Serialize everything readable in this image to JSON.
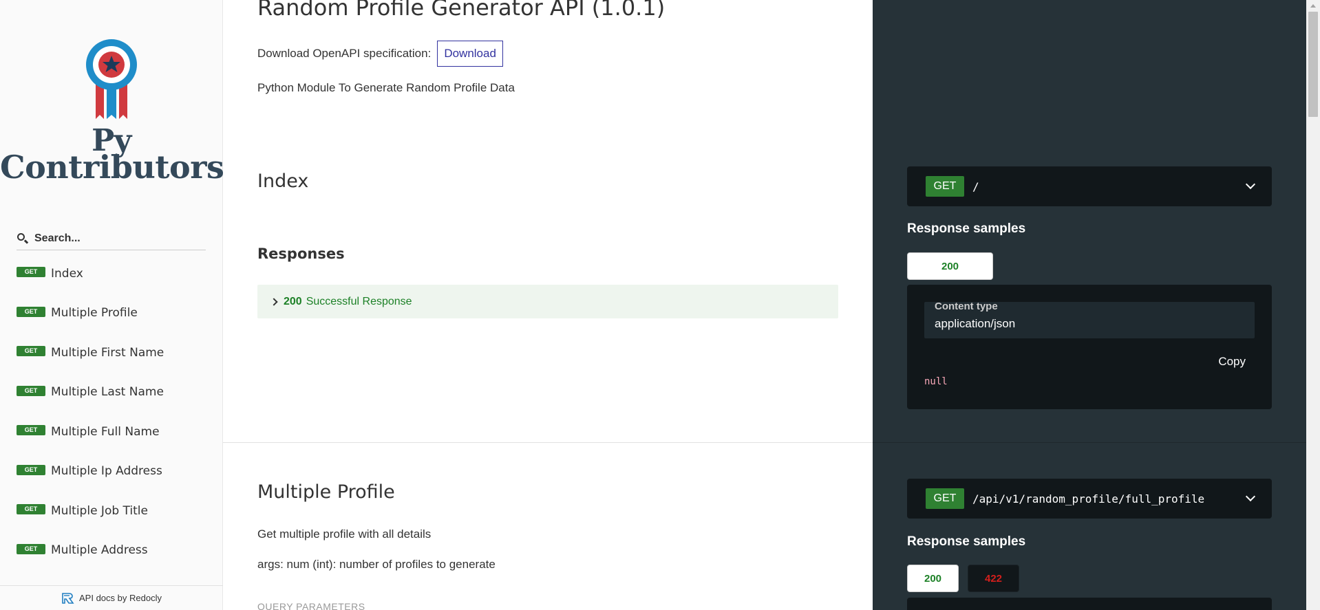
{
  "sidebar": {
    "logo": {
      "line1": "Py",
      "line2": "Contributors"
    },
    "search": {
      "placeholder": "Search..."
    },
    "items": [
      {
        "method": "GET",
        "label": "Index"
      },
      {
        "method": "GET",
        "label": "Multiple Profile"
      },
      {
        "method": "GET",
        "label": "Multiple First Name"
      },
      {
        "method": "GET",
        "label": "Multiple Last Name"
      },
      {
        "method": "GET",
        "label": "Multiple Full Name"
      },
      {
        "method": "GET",
        "label": "Multiple Ip Address"
      },
      {
        "method": "GET",
        "label": "Multiple Job Title"
      },
      {
        "method": "GET",
        "label": "Multiple Address"
      }
    ],
    "footer": "API docs by Redocly"
  },
  "main": {
    "title": "Random Profile Generator API (1.0.1)",
    "download_text": "Download OpenAPI specification:",
    "download_button": "Download",
    "description": "Python Module To Generate Random Profile Data",
    "index": {
      "title": "Index",
      "responses_title": "Responses",
      "response": {
        "code": "200",
        "text": "Successful Response"
      }
    },
    "multiple_profile": {
      "title": "Multiple Profile",
      "desc1": "Get multiple profile with all details",
      "desc2": "args: num (int): number of profiles to generate",
      "query_params": "QUERY PARAMETERS"
    }
  },
  "right": {
    "op1": {
      "method": "GET",
      "path": "/",
      "samples_title": "Response samples",
      "status": "200",
      "content_type_label": "Content type",
      "content_type": "application/json",
      "copy": "Copy",
      "code": "null"
    },
    "op2": {
      "method": "GET",
      "path": "/api/v1/random_profile/full_profile",
      "samples_title": "Response samples",
      "status_ok": "200",
      "status_err": "422"
    }
  },
  "colors": {
    "get_badge": "#2f8132",
    "dark_panel": "#263238",
    "code_bg": "#11171a",
    "link": "#32329f",
    "success": "#1d8127",
    "error": "#d41f1c"
  }
}
